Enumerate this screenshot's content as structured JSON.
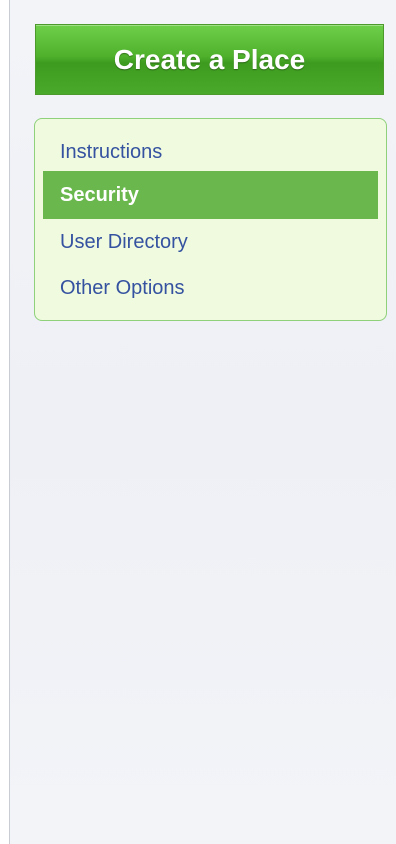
{
  "create_button": {
    "label": "Create a Place"
  },
  "nav": {
    "items": [
      {
        "label": "Instructions",
        "active": false
      },
      {
        "label": "Security",
        "active": true
      },
      {
        "label": "User Directory",
        "active": false
      },
      {
        "label": "Other Options",
        "active": false
      }
    ]
  },
  "colors": {
    "accent_green": "#4fb12c",
    "active_item_bg": "#6ab84d",
    "nav_box_bg": "#effadf",
    "nav_box_border": "#8fd07a",
    "link_blue": "#3552a0",
    "panel_bg": "#f3f4f8"
  }
}
